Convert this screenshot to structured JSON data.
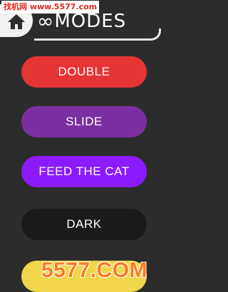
{
  "watermark": {
    "top": "找机网 www.5577.com",
    "bottom": "5577.COM"
  },
  "header": {
    "title": "MODES",
    "infinity_symbol": "∞",
    "home_icon": "home-icon"
  },
  "modes": [
    {
      "label": "DOUBLE",
      "color": "#e53434"
    },
    {
      "label": "SLIDE",
      "color": "#7b2fa0"
    },
    {
      "label": "FEED THE CAT",
      "color": "#8c1aff"
    },
    {
      "label": "DARK",
      "color": "#1a1a1a"
    }
  ],
  "partial_mode": {
    "color": "#f0d648"
  },
  "colors": {
    "background": "#2c2c2c",
    "accent": "#f2f2f2"
  }
}
